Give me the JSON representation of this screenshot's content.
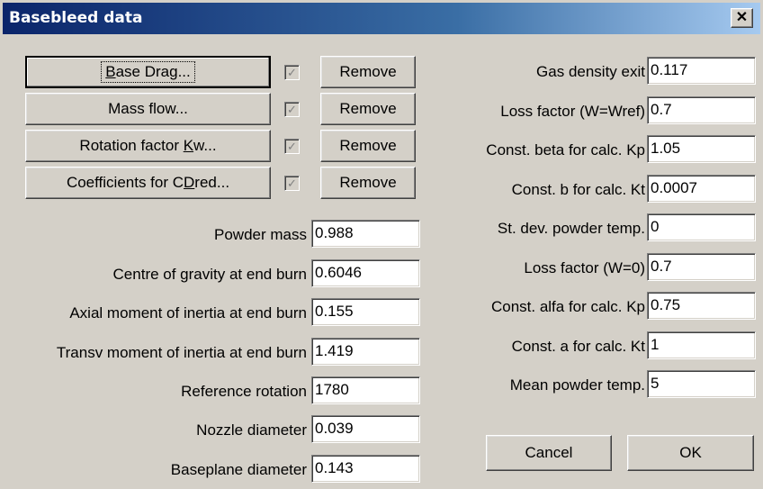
{
  "window": {
    "title": "Basebleed data",
    "close": "✕"
  },
  "rows": [
    {
      "pre": "",
      "key": "B",
      "post": "ase Drag...",
      "checked": true,
      "remove": "Remove"
    },
    {
      "pre": "Mass flow...",
      "key": "",
      "post": "",
      "checked": true,
      "remove": "Remove"
    },
    {
      "pre": "Rotation factor ",
      "key": "K",
      "post": "w...",
      "checked": true,
      "remove": "Remove"
    },
    {
      "pre": "Coefficients for C",
      "key": "D",
      "post": "red...",
      "checked": true,
      "remove": "Remove"
    }
  ],
  "check_glyph": "✓",
  "left_fields": [
    {
      "label": "Powder mass",
      "value": "0.988"
    },
    {
      "label": "Centre of gravity at end burn",
      "value": "0.6046"
    },
    {
      "label": "Axial moment of inertia at end burn",
      "value": "0.155"
    },
    {
      "label": "Transv moment of inertia at end burn",
      "value": "1.419"
    },
    {
      "label": "Reference rotation",
      "value": "1780"
    },
    {
      "label": "Nozzle diameter",
      "value": "0.039"
    },
    {
      "label": "Baseplane diameter",
      "value": "0.143"
    }
  ],
  "right_fields": [
    {
      "label": "Gas density exit",
      "value": "0.117"
    },
    {
      "label": "Loss factor (W=Wref)",
      "value": "0.7"
    },
    {
      "label": "Const. beta for calc. Kp",
      "value": "1.05"
    },
    {
      "label": "Const. b for calc. Kt",
      "value": "0.0007"
    },
    {
      "label": "St. dev. powder temp.",
      "value": "0"
    },
    {
      "label": "Loss factor (W=0)",
      "value": "0.7"
    },
    {
      "label": "Const. alfa for calc. Kp",
      "value": "0.75"
    },
    {
      "label": "Const. a for calc. Kt",
      "value": "1"
    },
    {
      "label": "Mean powder temp.",
      "value": "5"
    }
  ],
  "buttons": {
    "cancel": "Cancel",
    "ok": "OK"
  }
}
